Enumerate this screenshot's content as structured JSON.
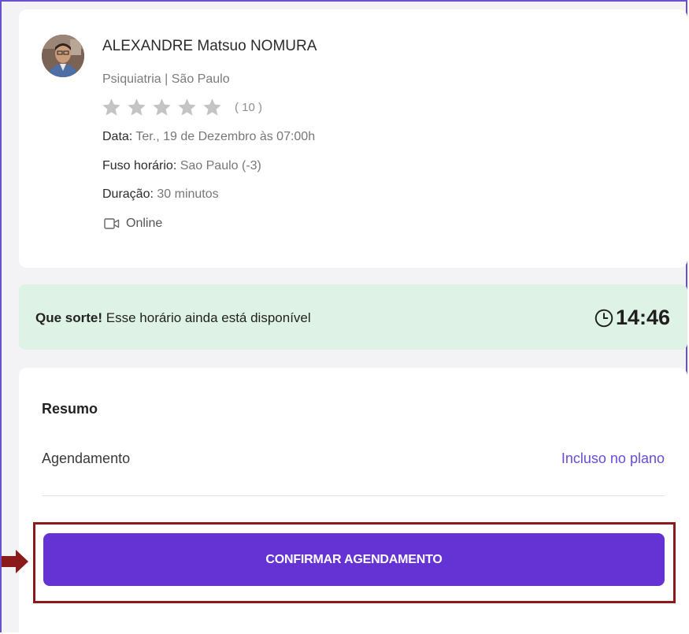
{
  "doctor": {
    "name": "ALEXANDRE Matsuo NOMURA",
    "specialty": "Psiquiatria | São Paulo",
    "rating": 0,
    "rating_count": "( 10 )",
    "date_label": "Data:",
    "date_value": "Ter., 19 de Dezembro às 07:00h",
    "timezone_label": "Fuso horário:",
    "timezone_value": "Sao Paulo (-3)",
    "duration_label": "Duração:",
    "duration_value": "30 minutos",
    "modality": "Online"
  },
  "banner": {
    "lead": "Que sorte!",
    "text": "Esse horário ainda está disponível",
    "timer": "14:46"
  },
  "summary": {
    "title": "Resumo",
    "item_label": "Agendamento",
    "item_value": "Incluso no plano"
  },
  "actions": {
    "confirm_label": "CONFIRMAR AGENDAMENTO"
  },
  "colors": {
    "accent": "#6532d4",
    "link": "#6a4bd8",
    "banner_bg": "#dff2e6",
    "highlight": "#8b1a1a",
    "star_inactive": "#c4c4c4"
  },
  "icons": {
    "avatar": "doctor-photo",
    "star": "star-icon",
    "video": "video-camera-icon",
    "clock": "clock-icon",
    "arrow": "arrow-right-icon"
  }
}
